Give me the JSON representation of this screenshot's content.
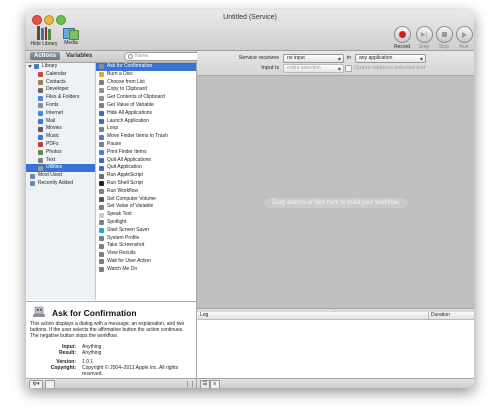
{
  "window": {
    "title": "Untitled (Service)"
  },
  "toolbar": {
    "library_label": "Hide Library",
    "media_label": "Media",
    "record_label": "Record",
    "step_label": "Step",
    "stop_label": "Stop",
    "run_label": "Run"
  },
  "library": {
    "tabs": [
      "Actions",
      "Variables"
    ],
    "search_placeholder": "Name",
    "categories": [
      "Library",
      "Calendar",
      "Contacts",
      "Developer",
      "Files & Folders",
      "Fonts",
      "Internet",
      "Mail",
      "Movies",
      "Music",
      "PDFs",
      "Photos",
      "Text",
      "Utilities",
      "Most Used",
      "Recently Added"
    ],
    "selected_category": "Utilities",
    "actions": [
      "Ask for Confirmation",
      "Burn a Disc",
      "Choose from List",
      "Copy to Clipboard",
      "Get Contents of Clipboard",
      "Get Value of Variable",
      "Hide All Applications",
      "Launch Application",
      "Loop",
      "Move Finder Items to Trash",
      "Pause",
      "Print Finder Items",
      "Quit All Applications",
      "Quit Application",
      "Run AppleScript",
      "Run Shell Script",
      "Run Workflow",
      "Set Computer Volume",
      "Set Value of Variable",
      "Speak Text",
      "Spotlight",
      "Start Screen Saver",
      "System Profile",
      "Take Screenshot",
      "View Results",
      "Wait for User Action",
      "Watch Me Do"
    ],
    "selected_action": "Ask for Confirmation"
  },
  "description": {
    "title": "Ask for Confirmation",
    "text": "This action displays a dialog with a message, an explanation, and two buttons. If the user selects the affirmative button the action continues. The negative button stops the workflow.",
    "input_label": "Input:",
    "input_value": "Anything",
    "result_label": "Result:",
    "result_value": "Anything",
    "version_label": "Version:",
    "version_value": "1.0.1",
    "copyright_label": "Copyright:",
    "copyright_value": "Copyright © 2004–2011 Apple Inc. All rights reserved."
  },
  "service": {
    "receives_label": "Service receives",
    "receives_value": "no input",
    "in_label": "in",
    "in_value": "any application",
    "input_is_label": "Input is",
    "input_is_value": "entire selection",
    "replaces_label": "Output replaces selected text"
  },
  "workflow": {
    "hint": "Drag actions or files here to build your workflow."
  },
  "log": {
    "col_log": "Log",
    "col_duration": "Duration"
  },
  "colors": {
    "selection": "#3b73d5",
    "canvas": "#bfbfbf",
    "record": "#d41e1e"
  }
}
